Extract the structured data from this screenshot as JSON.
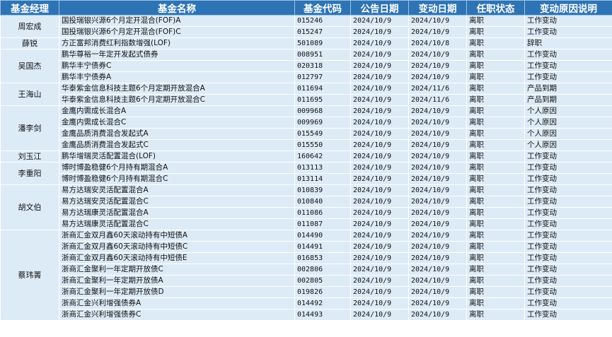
{
  "headers": [
    "基金经理",
    "基金名称",
    "基金代码",
    "公告日期",
    "变动日期",
    "任职状态",
    "变动原因说明"
  ],
  "groups": [
    {
      "manager": "周宏成",
      "rows": [
        {
          "name": "国投瑞银兴源6个月定开混合(FOF)A",
          "code": "015246",
          "announce": "2024/10/9",
          "change": "2024/10/9",
          "status": "离职",
          "reason": "工作变动"
        },
        {
          "name": "国投瑞银兴源6个月定开混合(FOF)C",
          "code": "015247",
          "announce": "2024/10/9",
          "change": "2024/10/9",
          "status": "离职",
          "reason": "工作变动"
        }
      ]
    },
    {
      "manager": "薛锐",
      "rows": [
        {
          "name": "方正富邦消费红利指数增强(LOF)",
          "code": "501089",
          "announce": "2024/10/9",
          "change": "2024/10/8",
          "status": "离职",
          "reason": "辞职"
        }
      ]
    },
    {
      "manager": "吴国杰",
      "rows": [
        {
          "name": "鹏华尊裕一年定开发起式债券",
          "code": "008951",
          "announce": "2024/10/9",
          "change": "2024/10/9",
          "status": "离职",
          "reason": "工作变动"
        },
        {
          "name": "鹏华丰宁债券C",
          "code": "020318",
          "announce": "2024/10/9",
          "change": "2024/10/9",
          "status": "离职",
          "reason": "工作变动"
        },
        {
          "name": "鹏华丰宁债券A",
          "code": "012797",
          "announce": "2024/10/9",
          "change": "2024/10/9",
          "status": "离职",
          "reason": "工作变动"
        }
      ]
    },
    {
      "manager": "王海山",
      "rows": [
        {
          "name": "华泰紫金信息科技主题6个月定期开放混合A",
          "code": "011694",
          "announce": "2024/10/9",
          "change": "2024/11/6",
          "status": "离职",
          "reason": "产品到期"
        },
        {
          "name": "华泰紫金信息科技主题6个月定期开放混合C",
          "code": "011695",
          "announce": "2024/10/9",
          "change": "2024/11/6",
          "status": "离职",
          "reason": "产品到期"
        }
      ]
    },
    {
      "manager": "潘李剑",
      "rows": [
        {
          "name": "金鹰内需成长混合A",
          "code": "009968",
          "announce": "2024/10/9",
          "change": "2024/10/9",
          "status": "离职",
          "reason": "个人原因"
        },
        {
          "name": "金鹰内需成长混合C",
          "code": "009969",
          "announce": "2024/10/9",
          "change": "2024/10/9",
          "status": "离职",
          "reason": "个人原因"
        },
        {
          "name": "金鹰品质消费混合发起式A",
          "code": "015549",
          "announce": "2024/10/9",
          "change": "2024/10/9",
          "status": "离职",
          "reason": "个人原因"
        },
        {
          "name": "金鹰品质消费混合发起式C",
          "code": "015550",
          "announce": "2024/10/9",
          "change": "2024/10/9",
          "status": "离职",
          "reason": "个人原因"
        }
      ]
    },
    {
      "manager": "刘玉江",
      "rows": [
        {
          "name": "鹏华增瑞灵活配置混合(LOF)",
          "code": "160642",
          "announce": "2024/10/9",
          "change": "2024/10/9",
          "status": "离职",
          "reason": "工作变动"
        }
      ]
    },
    {
      "manager": "李重阳",
      "rows": [
        {
          "name": "博时博盈稳健6个月持有期混合A",
          "code": "013113",
          "announce": "2024/10/9",
          "change": "2024/10/9",
          "status": "离职",
          "reason": "工作变动"
        },
        {
          "name": "博时博盈稳健6个月持有期混合C",
          "code": "013114",
          "announce": "2024/10/9",
          "change": "2024/10/9",
          "status": "离职",
          "reason": "工作变动"
        }
      ]
    },
    {
      "manager": "胡文伯",
      "rows": [
        {
          "name": "易方达瑞安灵活配置混合A",
          "code": "010839",
          "announce": "2024/10/9",
          "change": "2024/10/9",
          "status": "离职",
          "reason": "工作变动"
        },
        {
          "name": "易方达瑞安灵活配置混合C",
          "code": "010840",
          "announce": "2024/10/9",
          "change": "2024/10/9",
          "status": "离职",
          "reason": "工作变动"
        },
        {
          "name": "易方达瑞康灵活配置混合A",
          "code": "011086",
          "announce": "2024/10/9",
          "change": "2024/10/9",
          "status": "离职",
          "reason": "工作变动"
        },
        {
          "name": "易方达瑞康灵活配置混合C",
          "code": "011087",
          "announce": "2024/10/9",
          "change": "2024/10/9",
          "status": "离职",
          "reason": "工作变动"
        }
      ]
    },
    {
      "manager": "蔡玮菁",
      "rows": [
        {
          "name": "浙商汇金双月鑫60天滚动持有中短债A",
          "code": "014490",
          "announce": "2024/10/9",
          "change": "2024/10/9",
          "status": "离职",
          "reason": "工作变动"
        },
        {
          "name": "浙商汇金双月鑫60天滚动持有中短债C",
          "code": "014491",
          "announce": "2024/10/9",
          "change": "2024/10/9",
          "status": "离职",
          "reason": "工作变动"
        },
        {
          "name": "浙商汇金双月鑫60天滚动持有中短债E",
          "code": "016853",
          "announce": "2024/10/9",
          "change": "2024/10/9",
          "status": "离职",
          "reason": "工作变动"
        },
        {
          "name": "浙商汇金聚利一年定期开放债C",
          "code": "002806",
          "announce": "2024/10/9",
          "change": "2024/10/9",
          "status": "离职",
          "reason": "工作变动"
        },
        {
          "name": "浙商汇金聚利一年定期开放债A",
          "code": "002805",
          "announce": "2024/10/9",
          "change": "2024/10/9",
          "status": "离职",
          "reason": "工作变动"
        },
        {
          "name": "浙商汇金聚利一年定期开放债D",
          "code": "019826",
          "announce": "2024/10/9",
          "change": "2024/10/9",
          "status": "离职",
          "reason": "工作变动"
        },
        {
          "name": "浙商汇金兴利增强债券A",
          "code": "014492",
          "announce": "2024/10/9",
          "change": "2024/10/9",
          "status": "离职",
          "reason": "工作变动"
        },
        {
          "name": "浙商汇金兴利增强债券C",
          "code": "014493",
          "announce": "2024/10/9",
          "change": "2024/10/9",
          "status": "离职",
          "reason": "工作变动"
        }
      ]
    }
  ]
}
